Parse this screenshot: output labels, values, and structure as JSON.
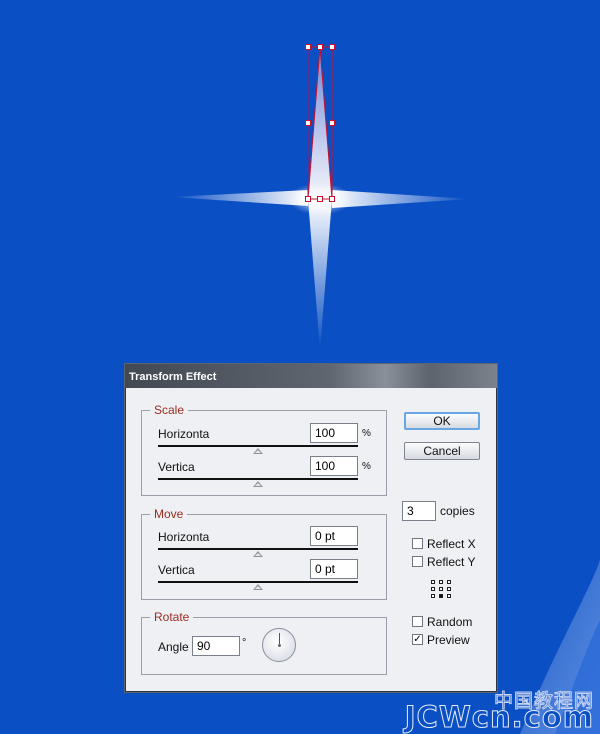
{
  "dialog": {
    "title": "Transform Effect",
    "scale": {
      "legend": "Scale",
      "horizontal_label": "Horizonta",
      "horizontal_value": "100",
      "horizontal_unit": "%",
      "vertical_label": "Vertica",
      "vertical_value": "100",
      "vertical_unit": "%"
    },
    "move": {
      "legend": "Move",
      "horizontal_label": "Horizonta",
      "horizontal_value": "0 pt",
      "vertical_label": "Vertica",
      "vertical_value": "0 pt"
    },
    "rotate": {
      "legend": "Rotate",
      "angle_label": "Angle",
      "angle_value": "90",
      "angle_unit": "°"
    },
    "buttons": {
      "ok": "OK",
      "cancel": "Cancel"
    },
    "copies": {
      "value": "3",
      "label": "copies"
    },
    "reflect_x": {
      "label": "Reflect X",
      "checked": false
    },
    "reflect_y": {
      "label": "Reflect Y",
      "checked": false
    },
    "random": {
      "label": "Random",
      "checked": false
    },
    "preview": {
      "label": "Preview",
      "checked": true,
      "mark": "✓"
    }
  },
  "watermark": {
    "chinese": "中国教程网",
    "brand": "JCWcn.com"
  },
  "colors": {
    "background": "#0a4fc4",
    "selection": "#c8102e",
    "legend_text": "#9b2d1f"
  }
}
